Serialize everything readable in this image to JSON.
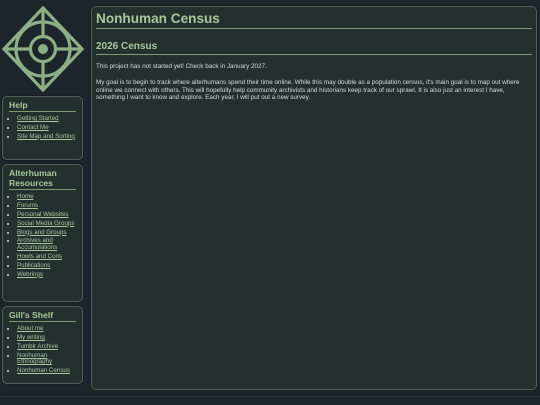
{
  "site": {
    "title": "Nonhuman Census"
  },
  "colors": {
    "background": "#1c2529",
    "panel": "#23302e",
    "accent": "#a9c79d",
    "border": "#51605b"
  },
  "logo": {
    "icon": "compass-emblem-icon"
  },
  "help": {
    "heading": "Help",
    "links": [
      "Getting Started",
      "Contact Me",
      "Site Map and Sorting"
    ]
  },
  "alterhuman": {
    "heading": "Alterhuman Resources",
    "links": [
      "Home",
      "Forums",
      "Personal Websites",
      "Social Media Groups",
      "Blogs and Groups",
      "Archives and Accumulations",
      "Howls and Cons",
      "Publications",
      "Webrings"
    ]
  },
  "shelf": {
    "heading": "Gill's Shelf",
    "links": [
      "About me",
      "My writing",
      "Tumblr Archive",
      "Nonhuman Ethnography",
      "Nonhuman Census"
    ]
  },
  "main": {
    "title": "Nonhuman Census",
    "subtitle": "2026 Census",
    "para1": "This project has not started yet! Check back in January 2027.",
    "para2": "My goal is to begin to track where alterhumans spend their time online. While this may double as a population census, it's main goal is to map out where online we connect with others. This will hopefully help community archivists and historians keep track of our sprawl. It is also just an interest I have, something I want to know and explore. Each year, I will put out a new survey."
  }
}
